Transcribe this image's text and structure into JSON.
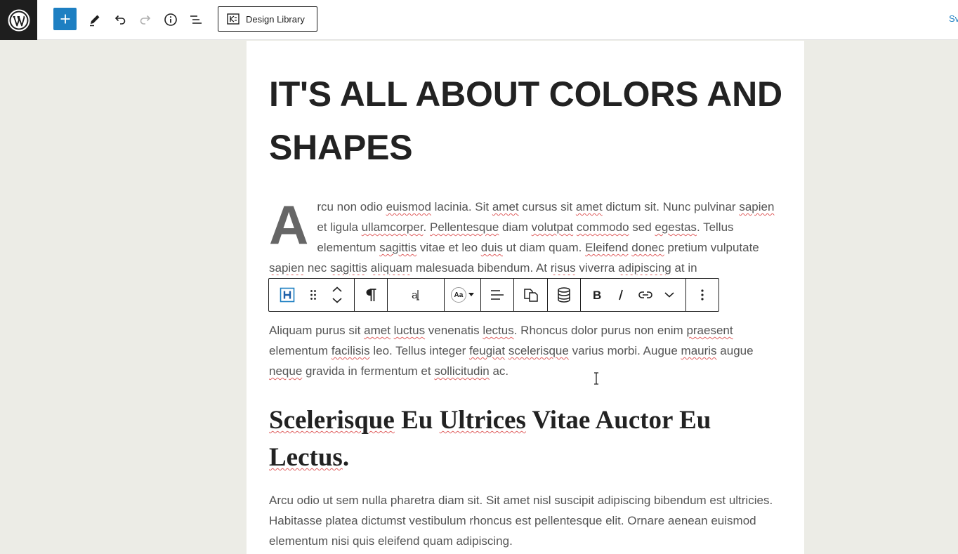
{
  "topbar": {
    "design_library_label": "Design Library",
    "right_link_label": "Sv"
  },
  "content": {
    "heading": "IT'S ALL ABOUT COLORS AND SHAPES",
    "paragraph1": {
      "dropcap": "A",
      "segments": [
        {
          "t": "rcu non odio ",
          "s": false
        },
        {
          "t": "euismod",
          "s": true
        },
        {
          "t": " lacinia. Sit ",
          "s": false
        },
        {
          "t": "amet",
          "s": true
        },
        {
          "t": " cursus sit ",
          "s": false
        },
        {
          "t": "amet",
          "s": true
        },
        {
          "t": " dictum sit. Nunc pulvinar ",
          "s": false
        },
        {
          "t": "sapien",
          "s": true
        },
        {
          "t": " et ligula ",
          "s": false
        },
        {
          "t": "ullamcorper",
          "s": true
        },
        {
          "t": ". ",
          "s": false
        },
        {
          "t": "Pellentesque",
          "s": true
        },
        {
          "t": " diam ",
          "s": false
        },
        {
          "t": "volutpat",
          "s": true
        },
        {
          "t": " ",
          "s": false
        },
        {
          "t": "commodo",
          "s": true
        },
        {
          "t": " sed ",
          "s": false
        },
        {
          "t": "egestas",
          "s": true
        },
        {
          "t": ". Tellus elementum ",
          "s": false
        },
        {
          "t": "sagittis",
          "s": true
        },
        {
          "t": " vitae et leo ",
          "s": false
        },
        {
          "t": "duis",
          "s": true
        },
        {
          "t": " ut diam quam. ",
          "s": false
        },
        {
          "t": "Eleifend",
          "s": true
        },
        {
          "t": " ",
          "s": false
        },
        {
          "t": "donec",
          "s": true
        },
        {
          "t": " pretium vulputate ",
          "s": false
        },
        {
          "t": "sapien",
          "s": true
        },
        {
          "t": " nec ",
          "s": false
        },
        {
          "t": "sagittis",
          "s": true
        },
        {
          "t": " ",
          "s": false
        },
        {
          "t": "aliquam",
          "s": true
        },
        {
          "t": " malesuada bibendum. At ",
          "s": false
        },
        {
          "t": "risus",
          "s": true
        },
        {
          "t": " viverra ",
          "s": false
        },
        {
          "t": "adipiscing",
          "s": true
        },
        {
          "t": " at in",
          "s": false
        }
      ]
    },
    "paragraph2": [
      {
        "t": "Aliquam purus sit ",
        "s": false
      },
      {
        "t": "amet",
        "s": true
      },
      {
        "t": " ",
        "s": false
      },
      {
        "t": "luctus",
        "s": true
      },
      {
        "t": " venenatis ",
        "s": false
      },
      {
        "t": "lectus",
        "s": true
      },
      {
        "t": ". Rhoncus dolor purus non enim ",
        "s": false
      },
      {
        "t": "praesent",
        "s": true
      },
      {
        "t": " elementum ",
        "s": false
      },
      {
        "t": "facilisis",
        "s": true
      },
      {
        "t": " leo. Tellus integer ",
        "s": false
      },
      {
        "t": "feugiat",
        "s": true
      },
      {
        "t": " ",
        "s": false
      },
      {
        "t": "scelerisque",
        "s": true
      },
      {
        "t": " varius morbi. Augue ",
        "s": false
      },
      {
        "t": "mauris",
        "s": true
      },
      {
        "t": " augue ",
        "s": false
      },
      {
        "t": "neque",
        "s": true
      },
      {
        "t": " gravida in fermentum et ",
        "s": false
      },
      {
        "t": "sollicitudin",
        "s": true
      },
      {
        "t": " ac.",
        "s": false
      }
    ],
    "subheading": [
      {
        "t": "Scelerisque",
        "s": true
      },
      {
        "t": " Eu ",
        "s": false
      },
      {
        "t": "Ultrices",
        "s": true
      },
      {
        "t": " Vitae Auctor Eu ",
        "s": false
      },
      {
        "t": "Lectus",
        "s": true
      },
      {
        "t": ".",
        "s": false
      }
    ],
    "paragraph3": "Arcu odio ut sem nulla pharetra diam sit. Sit amet nisl suscipit adipiscing bibendum est ultricies. Habitasse platea dictumst vestibulum rhoncus est pellentesque elit. Ornare aenean euismod elementum nisi quis eleifend quam adipiscing."
  },
  "block_toolbar": {
    "block_type_icon": "heading-block-icon",
    "font_size_label": "Aa"
  },
  "colors": {
    "accent": "#1d7fc2",
    "dark": "#1e1e1e",
    "canvas_bg": "#ecece6"
  }
}
